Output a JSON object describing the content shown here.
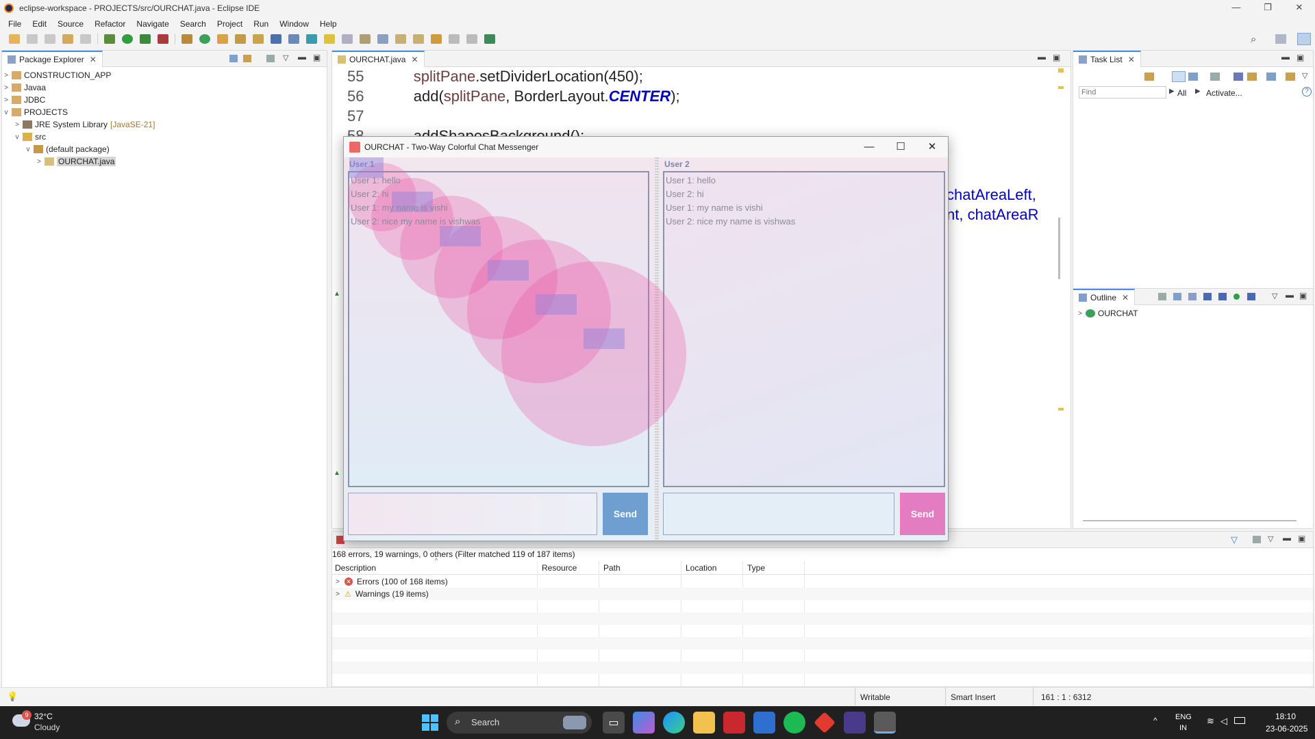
{
  "window": {
    "title": "eclipse-workspace - PROJECTS/src/OURCHAT.java - Eclipse IDE"
  },
  "menu": [
    "File",
    "Edit",
    "Source",
    "Refactor",
    "Navigate",
    "Search",
    "Project",
    "Run",
    "Window",
    "Help"
  ],
  "package_explorer": {
    "tab_label": "Package Explorer",
    "items": [
      {
        "label": "CONSTRUCTION_APP",
        "arrow": ">"
      },
      {
        "label": "Javaa",
        "arrow": ">"
      },
      {
        "label": "JDBC",
        "arrow": ">"
      },
      {
        "label": "PROJECTS",
        "arrow": "v"
      },
      {
        "label": "JRE System Library",
        "suffix": "[JavaSE-21]",
        "arrow": ">"
      },
      {
        "label": "src",
        "arrow": "v"
      },
      {
        "label": "(default package)",
        "arrow": "v"
      },
      {
        "label": "OURCHAT.java",
        "arrow": ">"
      }
    ]
  },
  "editor": {
    "tab_label": "OURCHAT.java",
    "lines": [
      {
        "num": "55",
        "a": "splitPane",
        "b": ".setDividerLocation(450);"
      },
      {
        "num": "56",
        "a": "add(",
        "b": "splitPane",
        "c": ", BorderLayout.",
        "d": "CENTER",
        "e": ");"
      },
      {
        "num": "57"
      },
      {
        "num": "58",
        "a": "addShapesBackground();"
      }
    ],
    "visible_right_1": "chatAreaLeft,",
    "visible_right_2": "nt, chatAreaR"
  },
  "task_list": {
    "tab_label": "Task List",
    "find_placeholder": "Find",
    "all_label": "All",
    "activate_label": "Activate..."
  },
  "outline": {
    "tab_label": "Outline",
    "item": "OURCHAT"
  },
  "chat_window": {
    "title": "OURCHAT - Two-Way Colorful Chat Messenger",
    "left": {
      "label": "User 1",
      "messages": [
        "User 1: hello",
        "User 2: hi",
        "User 1: my name is vishi",
        "User 2: nice my name is vishwas"
      ],
      "send_label": "Send",
      "send_color": "#6f9fd0"
    },
    "right": {
      "label": "User 2",
      "messages": [
        "User 1: hello",
        "User 2: hi",
        "User 1: my name is vishi",
        "User 2: nice my name is vishwas"
      ],
      "send_label": "Send",
      "send_color": "#e37cc0"
    }
  },
  "problems": {
    "summary": "168 errors, 19 warnings, 0 others (Filter matched 119 of 187 items)",
    "columns": [
      "Description",
      "Resource",
      "Path",
      "Location",
      "Type"
    ],
    "rows": [
      {
        "label": "Errors (100 of 168 items)",
        "icon": "error"
      },
      {
        "label": "Warnings (19 items)",
        "icon": "warning"
      }
    ]
  },
  "status": {
    "writable": "Writable",
    "insert_mode": "Smart Insert",
    "position": "161 : 1 : 6312"
  },
  "taskbar": {
    "weather_temp": "32°C",
    "weather_desc": "Cloudy",
    "weather_badge": "9",
    "search_label": "Search",
    "lang_top": "ENG",
    "lang_bottom": "IN",
    "time": "18:10",
    "date": "23-06-2025"
  }
}
